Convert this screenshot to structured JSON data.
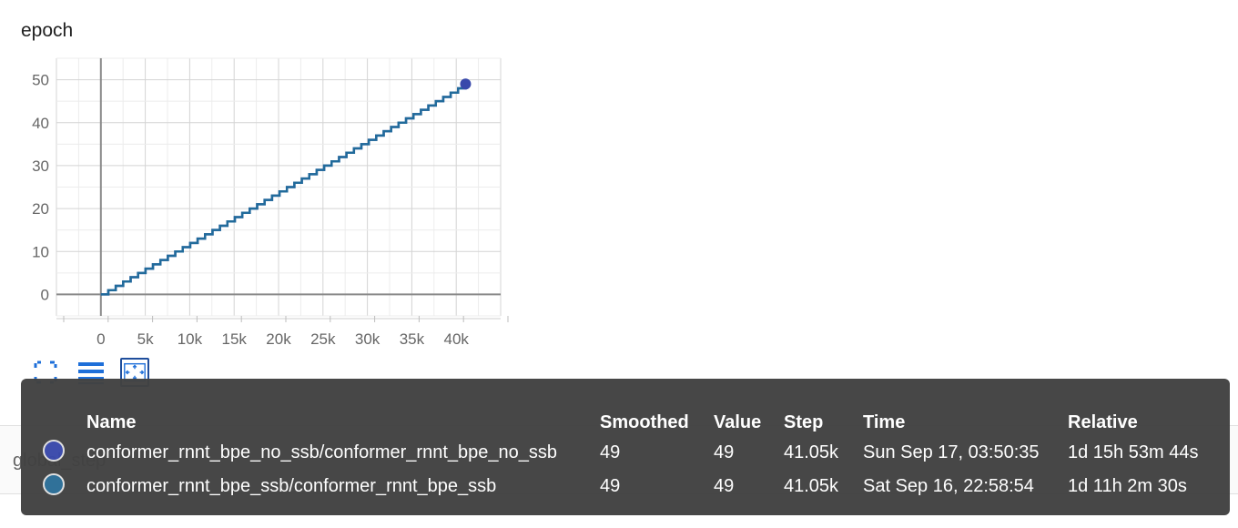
{
  "card": {
    "title": "epoch"
  },
  "chart_data": {
    "type": "line",
    "title": "epoch",
    "xlabel": "",
    "ylabel": "",
    "xlim": [
      -5000,
      45000
    ],
    "ylim": [
      -5,
      55
    ],
    "x_ticks": [
      0,
      5000,
      10000,
      15000,
      20000,
      25000,
      30000,
      35000,
      40000
    ],
    "x_tick_labels": [
      "0",
      "5k",
      "10k",
      "15k",
      "20k",
      "25k",
      "30k",
      "35k",
      "40k"
    ],
    "y_ticks": [
      0,
      10,
      20,
      30,
      40,
      50
    ],
    "y_tick_labels": [
      "0",
      "10",
      "20",
      "30",
      "40",
      "50"
    ],
    "grid": true,
    "step_shape": true,
    "series": [
      {
        "name": "conformer_rnnt_bpe_no_ssb/conformer_rnnt_bpe_no_ssb",
        "color": "#3949ab",
        "x_start": 0,
        "x_end": 41050,
        "y_start": 0,
        "y_end": 49
      },
      {
        "name": "conformer_rnnt_bpe_ssb/conformer_rnnt_bpe_ssb",
        "color": "#1f6f99",
        "x_start": 0,
        "x_end": 41050,
        "y_start": 0,
        "y_end": 49
      }
    ]
  },
  "toolbar": {
    "icons": [
      "fullscreen-icon",
      "toggle-log-scale-icon",
      "fit-domain-icon"
    ]
  },
  "tooltip": {
    "headers": {
      "name": "Name",
      "smoothed": "Smoothed",
      "value": "Value",
      "step": "Step",
      "time": "Time",
      "relative": "Relative"
    },
    "rows": [
      {
        "color": "#3949ab",
        "name": "conformer_rnnt_bpe_no_ssb/conformer_rnnt_bpe_no_ssb",
        "smoothed": "49",
        "value": "49",
        "step": "41.05k",
        "time": "Sun Sep 17, 03:50:35",
        "relative": "1d 15h 53m 44s"
      },
      {
        "color": "#2a6d96",
        "name": "conformer_rnnt_bpe_ssb/conformer_rnnt_bpe_ssb",
        "smoothed": "49",
        "value": "49",
        "step": "41.05k",
        "time": "Sat Sep 16, 22:58:54",
        "relative": "1d 11h 2m 30s"
      }
    ]
  },
  "below": {
    "section_label": "global_step",
    "next_label": ""
  }
}
